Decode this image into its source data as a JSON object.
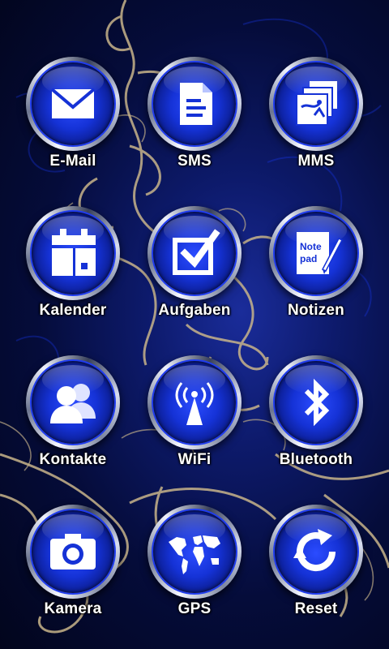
{
  "colors": {
    "accent": "#1a3cff",
    "background": "#050c3a",
    "ornament": "#c8b48a"
  },
  "apps": [
    {
      "label": "E-Mail",
      "icon": "envelope-icon"
    },
    {
      "label": "SMS",
      "icon": "document-icon"
    },
    {
      "label": "MMS",
      "icon": "picture-message-icon"
    },
    {
      "label": "Kalender",
      "icon": "calendar-icon"
    },
    {
      "label": "Aufgaben",
      "icon": "checkbox-icon"
    },
    {
      "label": "Notizen",
      "icon": "notepad-icon",
      "icon_text": [
        "Note",
        "pad"
      ]
    },
    {
      "label": "Kontakte",
      "icon": "contacts-icon"
    },
    {
      "label": "WiFi",
      "icon": "wifi-tower-icon"
    },
    {
      "label": "Bluetooth",
      "icon": "bluetooth-icon"
    },
    {
      "label": "Kamera",
      "icon": "camera-icon"
    },
    {
      "label": "GPS",
      "icon": "world-map-icon"
    },
    {
      "label": "Reset",
      "icon": "reset-icon"
    }
  ]
}
